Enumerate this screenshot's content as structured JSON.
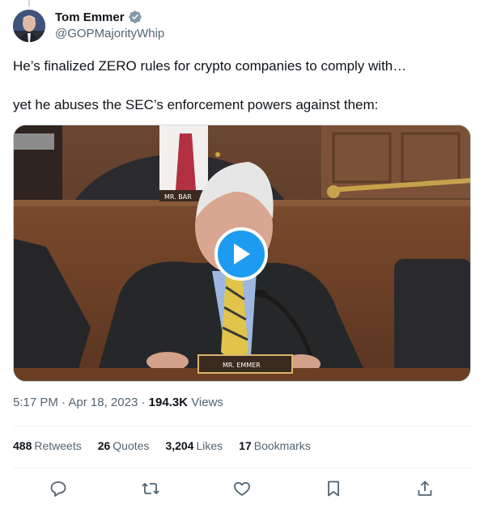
{
  "author": {
    "display_name": "Tom Emmer",
    "handle": "@GOPMajorityWhip",
    "verified_badge_icon": "verified-badge-icon"
  },
  "tweet": {
    "text_lines": [
      "He’s finalized ZERO rules for crypto companies to comply with…",
      "yet he abuses the SEC’s enforcement powers against them:"
    ]
  },
  "media": {
    "type": "video",
    "play_icon": "play-icon",
    "nameplates": [
      "MR. BAR",
      "MR. EMMER"
    ]
  },
  "meta": {
    "time": "5:17 PM",
    "date": "Apr 18, 2023",
    "separator": "·",
    "views_count": "194.3K",
    "views_label": "Views"
  },
  "stats": {
    "retweets_count": "488",
    "retweets_label": "Retweets",
    "quotes_count": "26",
    "quotes_label": "Quotes",
    "likes_count": "3,204",
    "likes_label": "Likes",
    "bookmarks_count": "17",
    "bookmarks_label": "Bookmarks"
  },
  "actions": [
    "reply-icon",
    "retweet-icon",
    "like-icon",
    "bookmark-icon",
    "share-icon"
  ],
  "colors": {
    "accent": "#1d9bf0",
    "text": "#0f1419",
    "muted": "#536471",
    "divider": "#eff3f4"
  }
}
